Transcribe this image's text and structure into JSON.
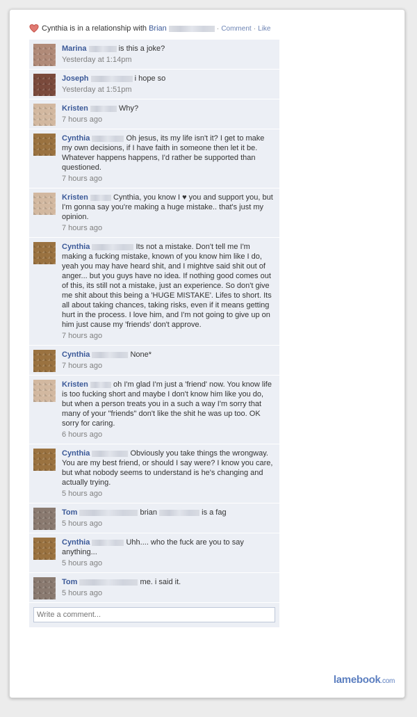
{
  "story": {
    "text": "Cynthia is in a relationship with",
    "partner": "Brian",
    "comment_link": "Comment",
    "like_link": "Like",
    "separator": "·"
  },
  "comments": [
    {
      "name": "Marina",
      "text": "is this a joke?",
      "time": "Yesterday at 1:14pm",
      "avatar_color": "#b08a78"
    },
    {
      "name": "Joseph",
      "text": "i hope so",
      "time": "Yesterday at 1:51pm",
      "avatar_color": "#7a4a3c"
    },
    {
      "name": "Kristen",
      "text": "Why?",
      "time": "7 hours ago",
      "avatar_color": "#d2b8a0"
    },
    {
      "name": "Cynthia",
      "text": "Oh jesus, its my life isn't it? I get to make my own decisions, if I have faith in someone then let it be. Whatever happens happens, I'd rather be supported than questioned.",
      "time": "7 hours ago",
      "avatar_color": "#9a7240"
    },
    {
      "name": "Kristen",
      "text": "Cynthia, you know I ♥ you and support you, but I'm gonna say you're making a huge mistake.. that's just my opinion.",
      "time": "7 hours ago",
      "avatar_color": "#d2b8a0"
    },
    {
      "name": "Cynthia",
      "text": "Its not a mistake. Don't tell me I'm making a fucking mistake, known of you know him like I do, yeah you may have heard shit, and I mightve said shit out of anger... but you guys have no idea. If nothing good comes out of this, its still not a mistake, just an experience. So don't give me shit about this being a 'HUGE MISTAKE'. Lifes to short. Its all about taking chances, taking risks, even if it means getting hurt in the process. I love him, and I'm not going to give up on him just cause my 'friends' don't approve.",
      "time": "7 hours ago",
      "avatar_color": "#9a7240"
    },
    {
      "name": "Cynthia",
      "text": "None*",
      "time": "7 hours ago",
      "avatar_color": "#9a7240"
    },
    {
      "name": "Kristen",
      "text": "oh I'm glad I'm just a 'friend' now. You know life is too fucking short and maybe I don't know him like you do, but when a person treats you in a such a way I'm sorry that many of your \"friends\" don't like the shit he was up too. OK sorry for caring.",
      "time": "6 hours ago",
      "avatar_color": "#d2b8a0"
    },
    {
      "name": "Cynthia",
      "text": "Obviously you take things the wrongway. You are my best friend, or should I say were? I know you care, but what nobody seems to understand is he's changing and actually trying.",
      "time": "5 hours ago",
      "avatar_color": "#9a7240"
    },
    {
      "name": "Tom",
      "text": "brian",
      "text2": "is a fag",
      "time": "5 hours ago",
      "avatar_color": "#8a7a70"
    },
    {
      "name": "Cynthia",
      "text": "Uhh.... who the fuck are you to say anything...",
      "time": "5 hours ago",
      "avatar_color": "#9a7240"
    },
    {
      "name": "Tom",
      "text": "me. i said it.",
      "time": "5 hours ago",
      "avatar_color": "#8a7a70"
    }
  ],
  "write_comment": {
    "placeholder": "Write a comment..."
  },
  "brand": {
    "name": "lamebook",
    "suffix": ".com"
  },
  "colors": {
    "link": "#3b5998",
    "comment_bg": "#eceff5",
    "heart": "#d9534f",
    "brand": "#5c7fc0"
  }
}
